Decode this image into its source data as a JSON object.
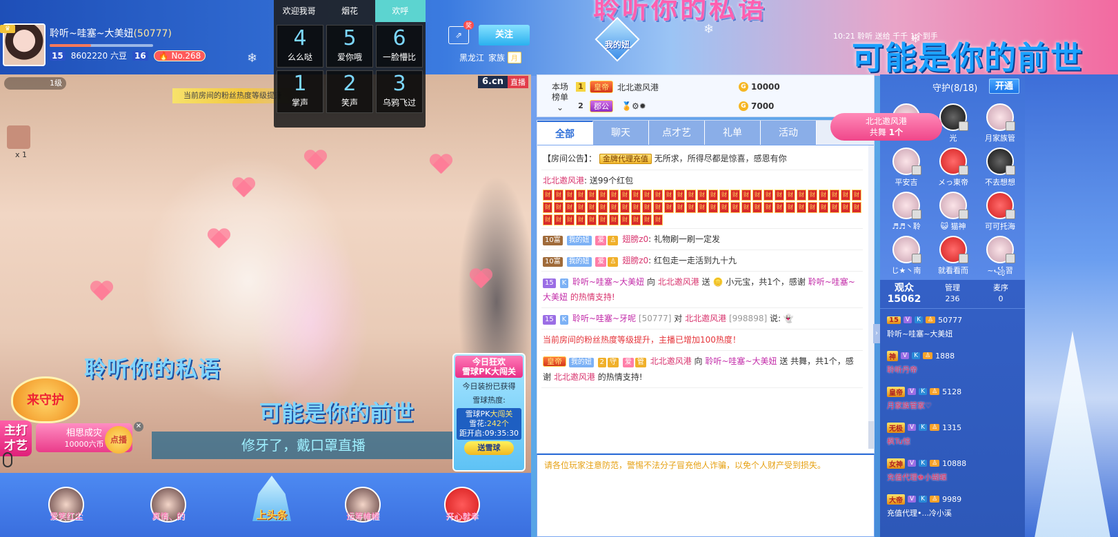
{
  "banner": {
    "title": "聆听你的私语",
    "right_text": "可能是你的前世",
    "info_time": "10:21",
    "info_name": "聆听",
    "info_send": "送给",
    "info_target": "千千",
    "info_count": "1个到手"
  },
  "streamer": {
    "name": "聆听~哇塞~大美妞",
    "room_id": "(50777)",
    "level": "15",
    "beans": "8602220 六豆",
    "fan_level": "16",
    "rank": "No.268",
    "location": "黑龙江",
    "clan_label": "家族",
    "clan_tag": "月",
    "share_tag": "奖",
    "follow_label": "关注",
    "progress_pct": 40
  },
  "logo": {
    "label": "我的妞"
  },
  "emoji_panel": {
    "tabs": [
      "欢迎我哥",
      "烟花",
      "欢呼"
    ],
    "active_tab": 2,
    "items": [
      {
        "num": "4",
        "label": "么么哒"
      },
      {
        "num": "5",
        "label": "爱你哦"
      },
      {
        "num": "6",
        "label": "一脸懵比"
      },
      {
        "num": "1",
        "label": "掌声"
      },
      {
        "num": "2",
        "label": "笑声"
      },
      {
        "num": "3",
        "label": "乌鸦飞过"
      }
    ]
  },
  "video": {
    "logo_cn": "6.cn",
    "logo_live": "直播",
    "level_chip": "1级",
    "notice": "当前房间的粉丝热度等级提升",
    "fan_count": "x 1",
    "title1": "聆听你的私语",
    "title2": "可能是你的前世",
    "guard_badge": "来守护",
    "subtitle": "修牙了，戴口罩直播",
    "host_tag_line1": "主打",
    "host_tag_line2": "才艺",
    "pk_name": "相思成灾",
    "pk_value": "10000六币",
    "pk_button": "点播",
    "snow": {
      "title_line1": "今日狂欢",
      "title_line2": "雪球PK大闯关",
      "line1": "今日装扮已获得",
      "line2": "雪球热度:",
      "pk_title_a": "雪球PK",
      "pk_title_b": "大闯关",
      "snow_label": "雪花:",
      "snow_value": "242个",
      "open_label": "距开启:",
      "open_value": "09:35:30",
      "button": "送雪球"
    }
  },
  "bottom": {
    "items": [
      "爱笑红尘",
      "真情、的",
      "运筹帷幄",
      "开心就幸"
    ],
    "up_label": "上头条"
  },
  "ranking": {
    "label_line1": "本场",
    "label_line2": "榜单",
    "rows": [
      {
        "no": "1",
        "title": "皇帝",
        "name": "北北邀风港",
        "value": "10000"
      },
      {
        "no": "2",
        "title": "郡公",
        "name": "",
        "value": "7000"
      }
    ]
  },
  "chat": {
    "tabs": [
      "全部",
      "聊天",
      "点才艺",
      "礼单",
      "活动"
    ],
    "active_tab": 0,
    "announce_label": "【房间公告】：",
    "announce_gold": "金牌代理充值",
    "announce_text": "无所求，所得尽都是惊喜，感恩有你",
    "hongbao_user": "北北邀风港",
    "hongbao_text": "送99个红包",
    "hongbao_char": "财",
    "hongbao_count": 69,
    "msg1_level": "10富",
    "msg1_fan": "我的妞",
    "msg1_user": "翅膀z0",
    "msg1_text": "礼物刷一刷一定发",
    "msg2_level": "10富",
    "msg2_fan": "我的妞",
    "msg2_user": "翅膀z0",
    "msg2_text": "红包走一走活到九十九",
    "msg3_level": "15",
    "msg3_user": "聆听~哇塞~大美妞",
    "msg3_to": "向",
    "msg3_target": "北北邀风港",
    "msg3_send": "送",
    "msg3_gift": "小元宝，共1个，感谢",
    "msg3_thanks_user": "聆听~哇塞~大美妞",
    "msg3_tail": "的热情支持!",
    "msg4_level": "15",
    "msg4_user": "聆听~哇塞~牙呢",
    "msg4_uid": "[50777]",
    "msg4_to": "对",
    "msg4_target": "北北邀风港",
    "msg4_target_id": "[998898]",
    "msg4_say": "说:",
    "system_text": "当前房间的粉丝热度等级提升，主播已增加100热度！",
    "msg5_title": "皇帝",
    "msg5_fan": "我的妞",
    "msg5_user": "北北邀风港",
    "msg5_to": "向",
    "msg5_target": "聆听~哇塞~大美妞",
    "msg5_send": "送",
    "msg5_gift": "共舞，共1个，感谢",
    "msg5_thanks_user": "北北邀风港",
    "msg5_tail": "的热情支持!"
  },
  "warning": "请各位玩家注意防范，警惕不法分子冒充他人诈骗，以免个人财产受到损失。",
  "guard": {
    "title": "守护(8/18)",
    "open_btn": "开通",
    "items": [
      {
        "name": "",
        "style": ""
      },
      {
        "name": "光",
        "style": "dark"
      },
      {
        "name": "月家族管",
        "style": ""
      },
      {
        "name": "平安吉",
        "style": ""
      },
      {
        "name": "メっ東帝",
        "style": "red"
      },
      {
        "name": "不去想想",
        "style": "dark"
      },
      {
        "name": "♬♬丶聆",
        "style": ""
      },
      {
        "name": "😺 猫神",
        "style": ""
      },
      {
        "name": "可可托海",
        "style": "red"
      },
      {
        "name": "じ★丶南",
        "style": ""
      },
      {
        "name": "就看看而",
        "style": "red"
      },
      {
        "name": "~꧁習",
        "style": ""
      }
    ]
  },
  "share_dance": {
    "user": "北北邀风港",
    "text": "共舞",
    "count": "1个"
  },
  "audience": {
    "viewers_label": "观众",
    "viewers_value": "15062",
    "admin_label": "管理",
    "admin_value": "236",
    "sort_label": "麦序",
    "sort_value": "0",
    "items": [
      {
        "badge": "15",
        "num": "50777",
        "name": "聆听~哇塞~大美妞",
        "white": true
      },
      {
        "badge": "神",
        "num": "1888",
        "name": "聆听丹帝",
        "white": false
      },
      {
        "badge": "皇帝",
        "num": "5128",
        "name": "月家族管家♡",
        "white": false
      },
      {
        "badge": "无极",
        "num": "1315",
        "name": "枫Tu惊",
        "white": false
      },
      {
        "badge": "女神",
        "num": "10888",
        "name": "充值代理♚小蝴蝶",
        "white": false
      },
      {
        "badge": "大帝",
        "num": "9989",
        "name": "充值代理•...冷小溪",
        "white": true
      }
    ]
  }
}
